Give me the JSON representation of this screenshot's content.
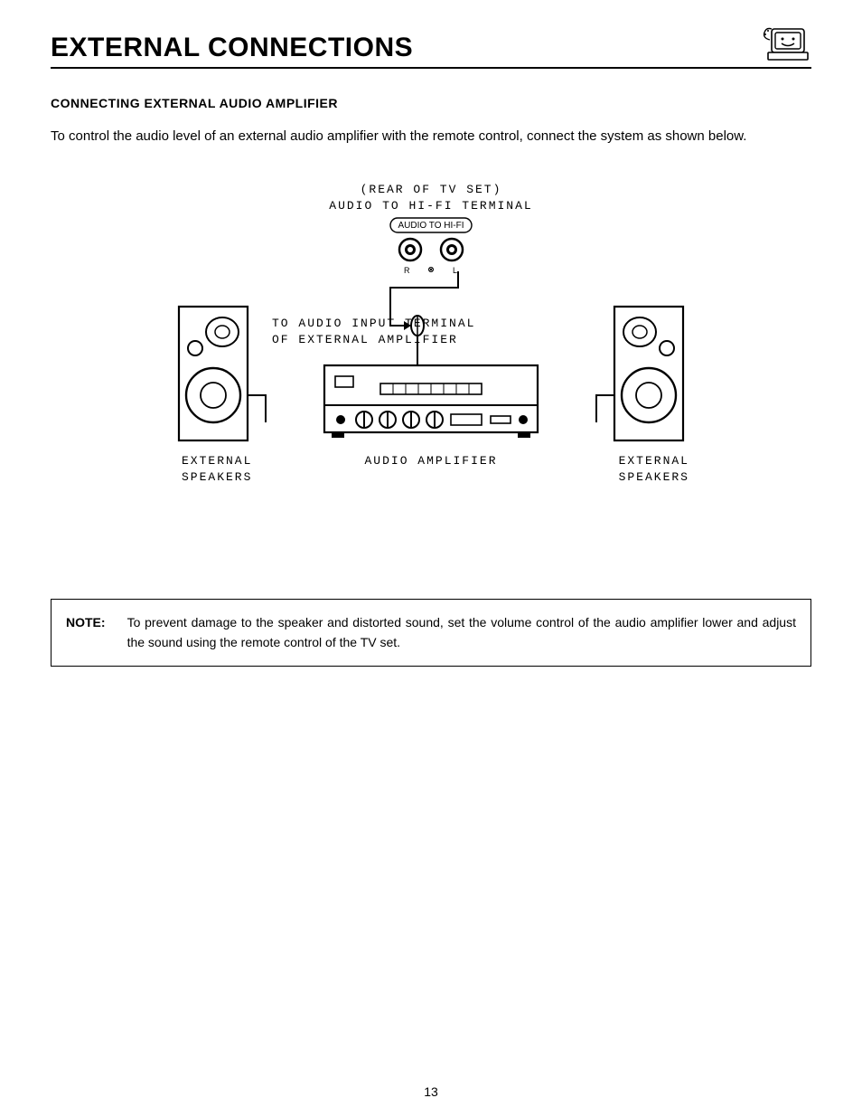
{
  "title": "EXTERNAL CONNECTIONS",
  "subheading": "CONNECTING EXTERNAL AUDIO AMPLIFIER",
  "intro": "To control the audio level of an external audio amplifier with the remote control, connect the system as shown below.",
  "diagram": {
    "rear_line1": "(REAR OF TV SET)",
    "rear_line2": "AUDIO TO HI-FI TERMINAL",
    "jack_panel_label": "AUDIO TO HI-FI",
    "jack_R": "R",
    "jack_L": "L",
    "to_input_line1": "TO AUDIO INPUT TERMINAL",
    "to_input_line2": "OF EXTERNAL AMPLIFIER",
    "amp_label": "AUDIO AMPLIFIER",
    "speakers_label_1a": "EXTERNAL",
    "speakers_label_1b": "SPEAKERS",
    "speakers_label_2a": "EXTERNAL",
    "speakers_label_2b": "SPEAKERS"
  },
  "note": {
    "label": "NOTE:",
    "text": "To prevent damage to the speaker and distorted sound, set the volume control of the audio amplifier lower and adjust the sound using the remote control of the TV set."
  },
  "page_number": "13"
}
